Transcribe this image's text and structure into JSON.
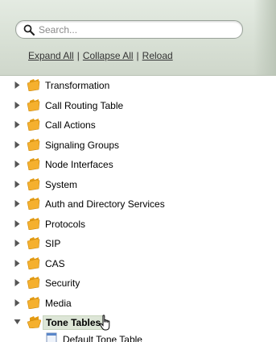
{
  "search": {
    "placeholder": "Search..."
  },
  "toolbar": {
    "expand_all": "Expand All",
    "collapse_all": "Collapse All",
    "reload": "Reload",
    "separator": "|"
  },
  "tree": {
    "items": [
      {
        "label": "Transformation",
        "expanded": false
      },
      {
        "label": "Call Routing Table",
        "expanded": false
      },
      {
        "label": "Call Actions",
        "expanded": false
      },
      {
        "label": "Signaling Groups",
        "expanded": false
      },
      {
        "label": "Node Interfaces",
        "expanded": false
      },
      {
        "label": "System",
        "expanded": false
      },
      {
        "label": "Auth and Directory Services",
        "expanded": false
      },
      {
        "label": "Protocols",
        "expanded": false
      },
      {
        "label": "SIP",
        "expanded": false
      },
      {
        "label": "CAS",
        "expanded": false
      },
      {
        "label": "Security",
        "expanded": false
      },
      {
        "label": "Media",
        "expanded": false
      },
      {
        "label": "Tone Tables",
        "expanded": true,
        "selected": true
      }
    ],
    "child": {
      "label": "Default Tone Table"
    }
  },
  "icons": {
    "node": "folder-icon",
    "child": "document-icon",
    "search": "magnifier-icon"
  },
  "colors": {
    "folder": "#f5b02e",
    "selected_bg": "#dde6d7",
    "panel": "#d8e0d5"
  }
}
